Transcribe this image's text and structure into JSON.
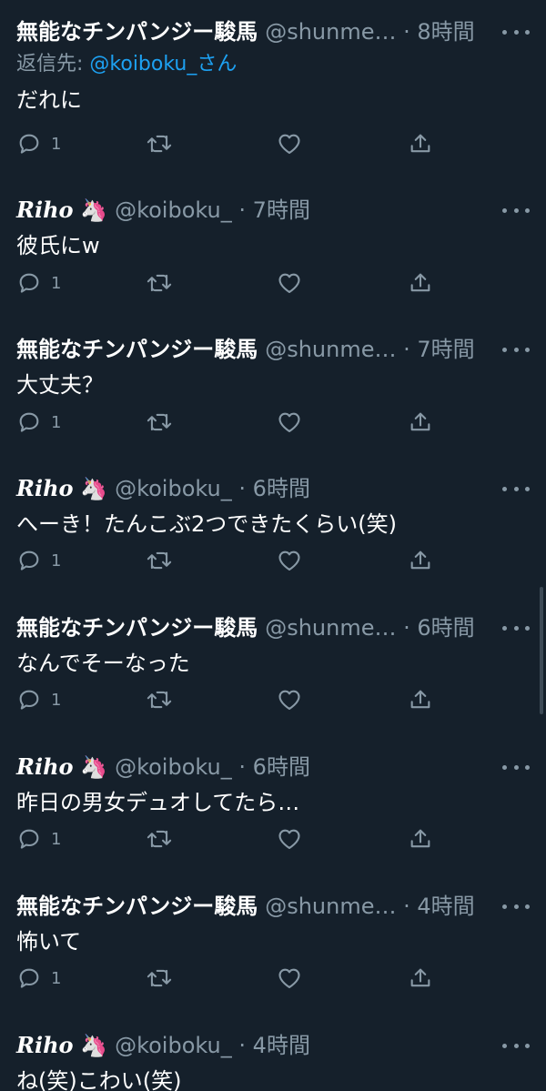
{
  "tweets": [
    {
      "name": "無能なチンパンジー駿馬",
      "handle": "@shunme…",
      "sep": "·",
      "time": "8時間",
      "reply_prefix": "返信先: ",
      "reply_handle": "@koiboku_さん",
      "text": "だれに",
      "reply_count": "1"
    },
    {
      "name": "Riho",
      "emoji": "🦄",
      "handle": "@koiboku_",
      "sep": "·",
      "time": "7時間",
      "text": "彼氏にw",
      "reply_count": "1"
    },
    {
      "name": "無能なチンパンジー駿馬",
      "handle": "@shunme…",
      "sep": "·",
      "time": "7時間",
      "text": "大丈夫？",
      "reply_count": "1"
    },
    {
      "name": "Riho",
      "emoji": "🦄",
      "handle": "@koiboku_",
      "sep": "·",
      "time": "6時間",
      "text": "へーき！たんこぶ2つできたくらい(笑)",
      "reply_count": "1"
    },
    {
      "name": "無能なチンパンジー駿馬",
      "handle": "@shunme…",
      "sep": "·",
      "time": "6時間",
      "text": "なんでそーなった",
      "reply_count": "1"
    },
    {
      "name": "Riho",
      "emoji": "🦄",
      "handle": "@koiboku_",
      "sep": "·",
      "time": "6時間",
      "text": "昨日の男女デュオしてたら…",
      "reply_count": "1"
    },
    {
      "name": "無能なチンパンジー駿馬",
      "handle": "@shunme…",
      "sep": "·",
      "time": "4時間",
      "text": "怖いて",
      "reply_count": "1"
    },
    {
      "name": "Riho",
      "emoji": "🦄",
      "handle": "@koiboku_",
      "sep": "·",
      "time": "4時間",
      "text": "ね(笑)こわい(笑)"
    }
  ],
  "colors": {
    "background": "#15202b",
    "secondary_text": "#8899a6",
    "link": "#1da1f2",
    "primary_text": "#ffffff"
  },
  "icons": {
    "reply": "reply-icon",
    "retweet": "retweet-icon",
    "like": "like-icon",
    "share": "share-icon",
    "more": "more-icon"
  }
}
